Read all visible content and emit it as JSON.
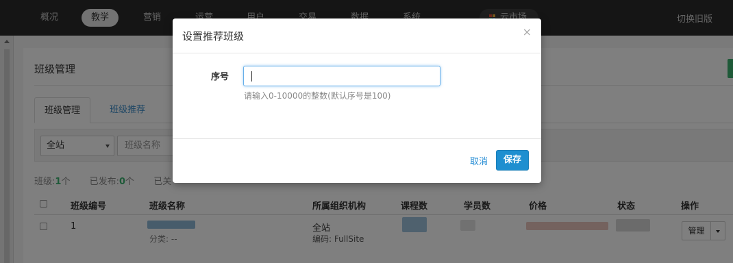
{
  "nav": {
    "items": [
      "概况",
      "教学",
      "营销",
      "运营",
      "用户",
      "交易",
      "数据",
      "系统"
    ],
    "active": "教学",
    "app_center": "云市场",
    "switch_old": "切换旧版"
  },
  "page": {
    "title": "班级管理",
    "tabs": [
      "班级管理",
      "班级推荐"
    ],
    "filter": {
      "site_select": "全站",
      "name_placeholder": "班级名称"
    },
    "stats": {
      "class_label": "班级:",
      "class_count": "1",
      "class_unit": "个",
      "published_label": "已发布:",
      "published_count": "0",
      "published_unit": "个",
      "closed_label": "已关"
    },
    "table": {
      "headers": [
        "班级编号",
        "班级名称",
        "所属组织机构",
        "课程数",
        "学员数",
        "价格",
        "状态",
        "操作"
      ],
      "rows": [
        {
          "id": "1",
          "category": "分类: --",
          "org": "全站",
          "org_code": "编码:  FullSite",
          "manage": "管理"
        }
      ]
    }
  },
  "modal": {
    "title": "设置推荐班级",
    "close": "×",
    "field_label": "序号",
    "field_value": "",
    "help": "请输入0-10000的整数(默认序号是100)",
    "cancel": "取消",
    "save": "保存"
  },
  "colors": {
    "primary": "#1e8fd0",
    "link": "#2a8fd6",
    "success": "#3cb371",
    "nav_bg": "#2b2b2b"
  }
}
